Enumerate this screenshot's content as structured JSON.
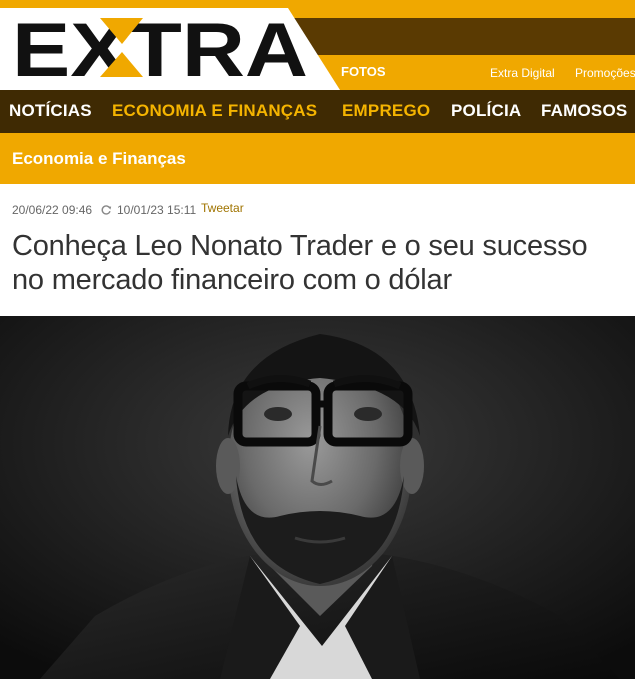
{
  "header": {
    "logo_text": "EXTRA",
    "links": {
      "fotos": "FOTOS",
      "extra_digital": "Extra Digital",
      "promocoes": "Promoções"
    }
  },
  "main_nav": {
    "items": [
      {
        "label": "NOTÍCIAS"
      },
      {
        "label": "ECONOMIA E FINANÇAS"
      },
      {
        "label": "EMPREGO"
      },
      {
        "label": "POLÍCIA"
      },
      {
        "label": "FAMOSOS"
      }
    ],
    "active_index": 1
  },
  "section": {
    "title": "Economia e Finanças"
  },
  "article": {
    "published": "20/06/22 09:46",
    "updated": "10/01/23 15:11",
    "tweet_label": "Tweetar",
    "headline": "Conheça Leo Nonato Trader e o seu sucesso no mercado financeiro com o dólar"
  },
  "icons": {
    "refresh": "refresh-icon"
  },
  "colors": {
    "brand_gold": "#f0a800",
    "nav_dark": "#3f2a03",
    "header_dark": "#5a3a02",
    "active_nav": "#f5b400",
    "headline_text": "#333333"
  }
}
